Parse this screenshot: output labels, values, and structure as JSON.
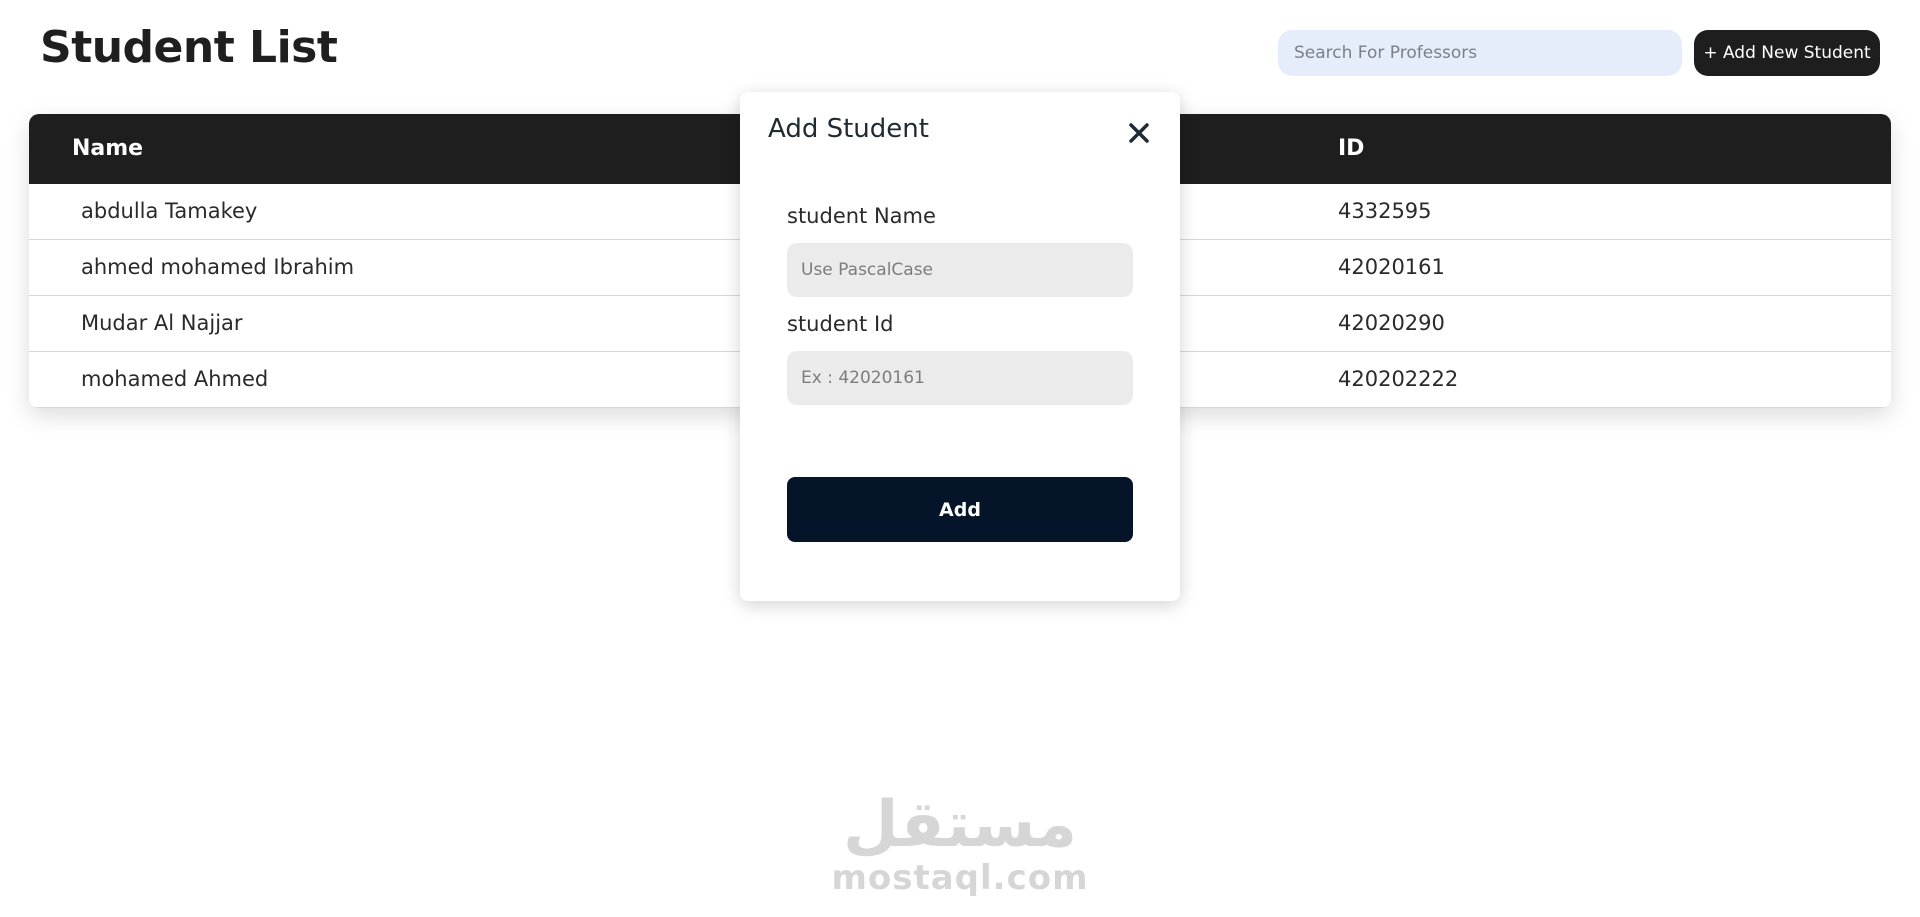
{
  "page": {
    "title": "Student List"
  },
  "header": {
    "search_placeholder": "Search For Professors",
    "add_new_label": "+ Add New Student"
  },
  "table": {
    "columns": {
      "name": "Name",
      "id": "ID"
    },
    "rows": [
      {
        "name": "abdulla Tamakey",
        "id": "4332595"
      },
      {
        "name": "ahmed mohamed Ibrahim",
        "id": "42020161"
      },
      {
        "name": "Mudar Al Najjar",
        "id": "42020290"
      },
      {
        "name": "mohamed Ahmed",
        "id": "420202222"
      }
    ]
  },
  "modal": {
    "title": "Add Student",
    "close_icon": "close-icon",
    "name_label": "student Name",
    "name_placeholder": "Use PascalCase",
    "id_label": "student Id",
    "id_placeholder": "Ex : 42020161",
    "submit_label": "Add"
  },
  "watermark": {
    "arabic": "مستقل",
    "latin": "mostaql.com"
  },
  "colors": {
    "header_bg": "#1e1e1e",
    "search_bg": "#e4edf9",
    "submit_bg": "#06142a",
    "input_bg": "#ebebeb"
  }
}
